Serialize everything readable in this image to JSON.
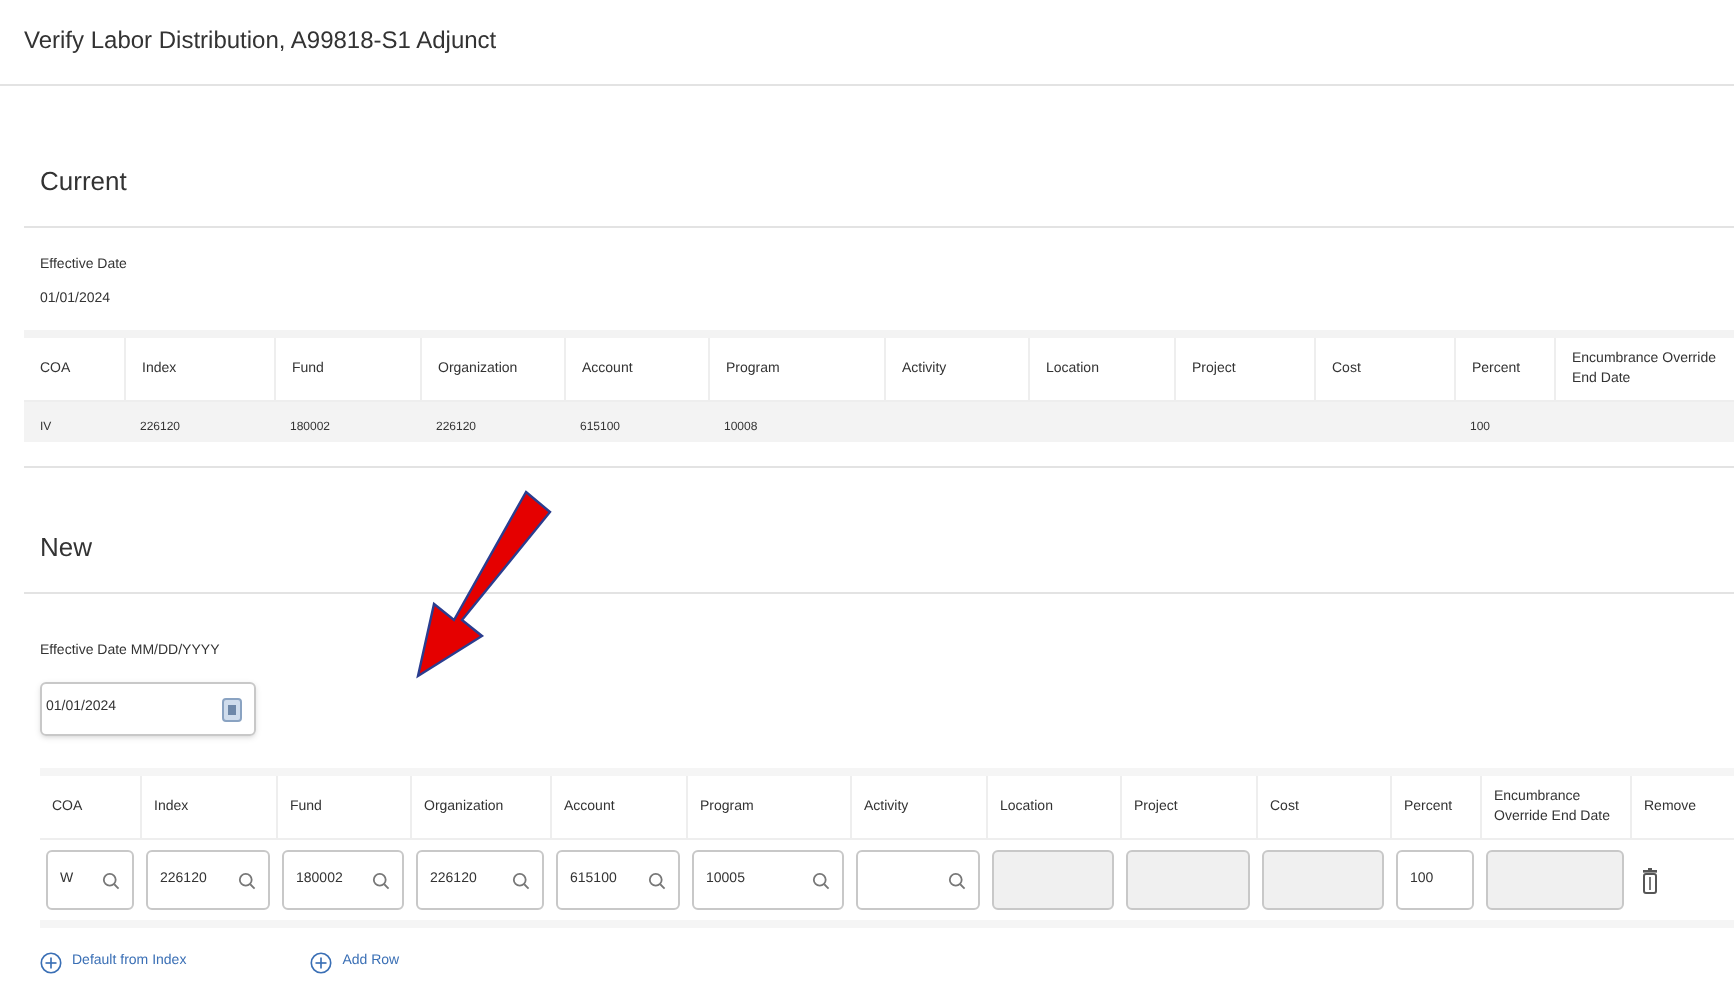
{
  "title": "Verify Labor Distribution, A99818-S1 Adjunct",
  "current": {
    "heading": "Current",
    "effective_date_label": "Effective Date",
    "effective_date": "01/01/2024",
    "columns": [
      "COA",
      "Index",
      "Fund",
      "Organization",
      "Account",
      "Program",
      "Activity",
      "Location",
      "Project",
      "Cost",
      "Percent",
      "Encumbrance Override End Date"
    ],
    "rows": [
      [
        "IV",
        "226120",
        "180002",
        "226120",
        "615100",
        "10008",
        null,
        null,
        null,
        null,
        "100",
        null
      ]
    ]
  },
  "new": {
    "heading": "New",
    "effective_date_label": "Effective Date MM/DD/YYYY",
    "effective_date": "01/01/2024",
    "columns": [
      "COA",
      "Index",
      "Fund",
      "Organization",
      "Account",
      "Program",
      "Activity",
      "Location",
      "Project",
      "Cost",
      "Percent",
      "Encumbrance Override End Date",
      "Remove"
    ],
    "rows": [
      {
        "cells": [
          {
            "kind": "lookup",
            "value": "W"
          },
          {
            "kind": "lookup",
            "value": "226120"
          },
          {
            "kind": "lookup",
            "value": "180002"
          },
          {
            "kind": "lookup",
            "value": "226120"
          },
          {
            "kind": "lookup",
            "value": "615100"
          },
          {
            "kind": "lookup",
            "value": "10005"
          },
          {
            "kind": "lookup"
          },
          {
            "kind": "disabled"
          },
          {
            "kind": "disabled"
          },
          {
            "kind": "disabled"
          },
          {
            "kind": "text",
            "value": "100"
          },
          {
            "kind": "disabled"
          },
          {
            "kind": "remove"
          }
        ]
      }
    ],
    "links": [
      "Default from Index",
      "Add Row"
    ]
  }
}
